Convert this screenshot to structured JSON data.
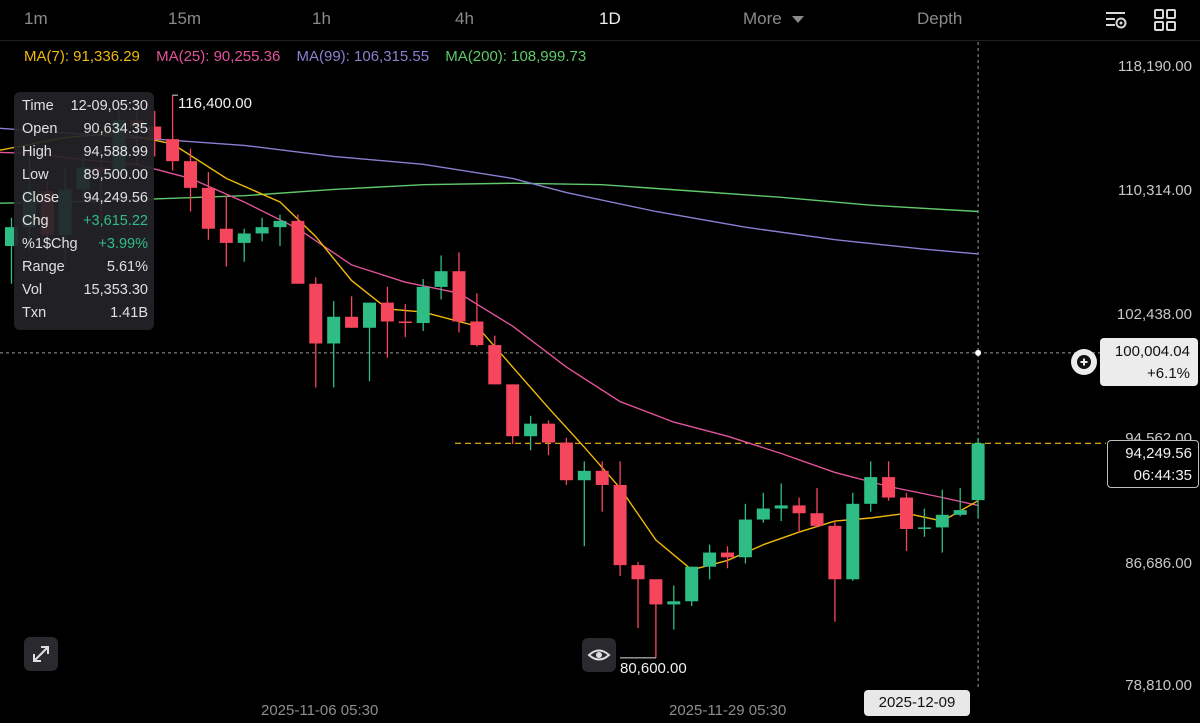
{
  "timeframes": [
    {
      "label": "1m",
      "active": false
    },
    {
      "label": "15m",
      "active": false
    },
    {
      "label": "1h",
      "active": false
    },
    {
      "label": "4h",
      "active": false
    },
    {
      "label": "1D",
      "active": true
    },
    {
      "label": "More",
      "active": false
    },
    {
      "label": "Depth",
      "active": false
    }
  ],
  "ma": [
    {
      "label": "MA(7): 91,336.29",
      "color": "#f0b90b"
    },
    {
      "label": "MA(25): 90,255.36",
      "color": "#e2539b"
    },
    {
      "label": "MA(99): 106,315.55",
      "color": "#8b7fd1"
    },
    {
      "label": "MA(200): 108,999.73",
      "color": "#5fc96b"
    }
  ],
  "y_axis_labels": [
    "118,190.00",
    "110,314.00",
    "102,438.00",
    "94,562.00",
    "86,686.00",
    "78,810.00"
  ],
  "x_axis_labels": [
    "2025-11-06 05:30",
    "2025-11-29 05:30"
  ],
  "info": {
    "rows": [
      {
        "k": "Time",
        "v": "12-09,05:30"
      },
      {
        "k": "Open",
        "v": "90,634.35"
      },
      {
        "k": "High",
        "v": "94,588.99"
      },
      {
        "k": "Low",
        "v": "89,500.00"
      },
      {
        "k": "Close",
        "v": "94,249.56"
      },
      {
        "k": "Chg",
        "v": "+3,615.22"
      },
      {
        "k": "%1$Chg",
        "v": "+3.99%"
      },
      {
        "k": "Range",
        "v": "5.61%"
      },
      {
        "k": "Vol",
        "v": "15,353.30"
      },
      {
        "k": "Txn",
        "v": "1.41B"
      }
    ]
  },
  "crosshair_price": "100,004.04",
  "crosshair_pct": "+6.1%",
  "current_price": "94,249.56",
  "countdown": "06:44:35",
  "crosshair_date": "2025-12-09",
  "high_label": "116,400.00",
  "low_label": "80,600.00",
  "colors": {
    "up": "#2ebd85",
    "down": "#f6465d",
    "ma7": "#f0b90b",
    "ma25": "#e2539b",
    "ma99": "#8b7fd1",
    "ma200": "#5fc96b"
  },
  "chart_data": {
    "type": "candlestick",
    "y_min": 78810,
    "y_max": 118190,
    "candles": [
      {
        "o": 106800,
        "h": 108600,
        "l": 104400,
        "c": 108000
      },
      {
        "o": 108000,
        "h": 112600,
        "l": 106500,
        "c": 110300
      },
      {
        "o": 110300,
        "h": 110900,
        "l": 106600,
        "c": 107500
      },
      {
        "o": 107500,
        "h": 111800,
        "l": 105500,
        "c": 110400
      },
      {
        "o": 110400,
        "h": 112600,
        "l": 109800,
        "c": 111800
      },
      {
        "o": 111800,
        "h": 113100,
        "l": 108400,
        "c": 111600
      },
      {
        "o": 111600,
        "h": 115800,
        "l": 111000,
        "c": 114800
      },
      {
        "o": 114800,
        "h": 115700,
        "l": 111900,
        "c": 114400
      },
      {
        "o": 114400,
        "h": 115400,
        "l": 112500,
        "c": 113600
      },
      {
        "o": 113600,
        "h": 116400,
        "l": 111600,
        "c": 112200
      },
      {
        "o": 112200,
        "h": 113000,
        "l": 109000,
        "c": 110500
      },
      {
        "o": 110500,
        "h": 111500,
        "l": 107200,
        "c": 107900
      },
      {
        "o": 107900,
        "h": 110000,
        "l": 105500,
        "c": 107000
      },
      {
        "o": 107000,
        "h": 107900,
        "l": 105800,
        "c": 107600
      },
      {
        "o": 107600,
        "h": 108600,
        "l": 107100,
        "c": 108000
      },
      {
        "o": 108000,
        "h": 108800,
        "l": 106800,
        "c": 108400
      },
      {
        "o": 108400,
        "h": 108800,
        "l": 104400,
        "c": 104400
      },
      {
        "o": 104400,
        "h": 104800,
        "l": 97800,
        "c": 100600
      },
      {
        "o": 100600,
        "h": 103300,
        "l": 97800,
        "c": 102300
      },
      {
        "o": 102300,
        "h": 103600,
        "l": 101600,
        "c": 101600
      },
      {
        "o": 101600,
        "h": 103200,
        "l": 98200,
        "c": 103200
      },
      {
        "o": 103200,
        "h": 104200,
        "l": 99700,
        "c": 102000
      },
      {
        "o": 102000,
        "h": 103100,
        "l": 101000,
        "c": 101900
      },
      {
        "o": 101900,
        "h": 104700,
        "l": 101400,
        "c": 104200
      },
      {
        "o": 104200,
        "h": 106200,
        "l": 103400,
        "c": 105200
      },
      {
        "o": 105200,
        "h": 106400,
        "l": 101300,
        "c": 102000
      },
      {
        "o": 102000,
        "h": 103800,
        "l": 100400,
        "c": 100500
      },
      {
        "o": 100500,
        "h": 101100,
        "l": 98000,
        "c": 98000
      },
      {
        "o": 98000,
        "h": 98000,
        "l": 94200,
        "c": 94700
      },
      {
        "o": 94700,
        "h": 96000,
        "l": 93800,
        "c": 95500
      },
      {
        "o": 95500,
        "h": 95700,
        "l": 93500,
        "c": 94300
      },
      {
        "o": 94300,
        "h": 94600,
        "l": 91600,
        "c": 91900
      },
      {
        "o": 91900,
        "h": 93100,
        "l": 87700,
        "c": 92500
      },
      {
        "o": 92500,
        "h": 93100,
        "l": 89900,
        "c": 91600
      },
      {
        "o": 91600,
        "h": 93100,
        "l": 85800,
        "c": 86500
      },
      {
        "o": 86500,
        "h": 86700,
        "l": 82500,
        "c": 85600
      },
      {
        "o": 85600,
        "h": 85600,
        "l": 80600,
        "c": 84000
      },
      {
        "o": 84000,
        "h": 85200,
        "l": 82400,
        "c": 84200
      },
      {
        "o": 84200,
        "h": 86400,
        "l": 83900,
        "c": 86400
      },
      {
        "o": 86400,
        "h": 87800,
        "l": 85600,
        "c": 87300
      },
      {
        "o": 87300,
        "h": 87700,
        "l": 86300,
        "c": 87000
      },
      {
        "o": 87000,
        "h": 90400,
        "l": 86600,
        "c": 89400
      },
      {
        "o": 89400,
        "h": 91100,
        "l": 89200,
        "c": 90100
      },
      {
        "o": 90100,
        "h": 91700,
        "l": 89300,
        "c": 90300
      },
      {
        "o": 90300,
        "h": 90800,
        "l": 88600,
        "c": 89800
      },
      {
        "o": 89800,
        "h": 91400,
        "l": 88900,
        "c": 89000
      },
      {
        "o": 89000,
        "h": 89300,
        "l": 82900,
        "c": 85600
      },
      {
        "o": 85600,
        "h": 91100,
        "l": 85500,
        "c": 90400
      },
      {
        "o": 90400,
        "h": 93100,
        "l": 89900,
        "c": 92100
      },
      {
        "o": 92100,
        "h": 93100,
        "l": 90600,
        "c": 90800
      },
      {
        "o": 90800,
        "h": 91100,
        "l": 87400,
        "c": 88800
      },
      {
        "o": 88800,
        "h": 90100,
        "l": 88300,
        "c": 88900
      },
      {
        "o": 88900,
        "h": 91300,
        "l": 87300,
        "c": 89700
      },
      {
        "o": 89700,
        "h": 91400,
        "l": 89600,
        "c": 90000
      },
      {
        "o": 90634.35,
        "h": 94588.99,
        "l": 89500,
        "c": 94249.56
      }
    ],
    "ma7": [
      [
        -2,
        112600
      ],
      [
        3,
        113700
      ],
      [
        6,
        114000
      ],
      [
        9,
        113300
      ],
      [
        12,
        111100
      ],
      [
        15,
        109600
      ],
      [
        17,
        107400
      ],
      [
        19,
        104600
      ],
      [
        21,
        102800
      ],
      [
        23,
        102600
      ],
      [
        26,
        101700
      ],
      [
        28,
        99100
      ],
      [
        30,
        96500
      ],
      [
        32,
        94000
      ],
      [
        34,
        91400
      ],
      [
        36,
        88100
      ],
      [
        38,
        86200
      ],
      [
        40,
        86800
      ],
      [
        42,
        87800
      ],
      [
        44,
        88600
      ],
      [
        46,
        89300
      ],
      [
        48,
        89500
      ],
      [
        50,
        89800
      ],
      [
        52,
        89300
      ],
      [
        54,
        90600
      ]
    ],
    "ma25": [
      [
        -2,
        112800
      ],
      [
        1,
        112700
      ],
      [
        4,
        112300
      ],
      [
        7,
        112000
      ],
      [
        10,
        111100
      ],
      [
        13,
        109600
      ],
      [
        16,
        107900
      ],
      [
        19,
        105600
      ],
      [
        22,
        104500
      ],
      [
        25,
        103800
      ],
      [
        28,
        101700
      ],
      [
        31,
        99100
      ],
      [
        34,
        96900
      ],
      [
        37,
        95600
      ],
      [
        40,
        94700
      ],
      [
        43,
        93600
      ],
      [
        46,
        92400
      ],
      [
        49,
        91500
      ],
      [
        52,
        90800
      ],
      [
        54,
        90300
      ]
    ],
    "ma99": [
      [
        -2,
        114400
      ],
      [
        3,
        114000
      ],
      [
        8,
        113600
      ],
      [
        13,
        113200
      ],
      [
        18,
        112500
      ],
      [
        23,
        112000
      ],
      [
        28,
        111100
      ],
      [
        31,
        110200
      ],
      [
        36,
        109000
      ],
      [
        41,
        108000
      ],
      [
        46,
        107200
      ],
      [
        51,
        106600
      ],
      [
        54,
        106300
      ]
    ],
    "ma200": [
      [
        -2,
        109500
      ],
      [
        3,
        109600
      ],
      [
        8,
        109800
      ],
      [
        13,
        110000
      ],
      [
        18,
        110400
      ],
      [
        23,
        110700
      ],
      [
        28,
        110800
      ],
      [
        33,
        110700
      ],
      [
        38,
        110300
      ],
      [
        43,
        109900
      ],
      [
        48,
        109400
      ],
      [
        54,
        109000
      ]
    ],
    "crosshair_y": 100004.04,
    "current_y": 94249.56
  }
}
